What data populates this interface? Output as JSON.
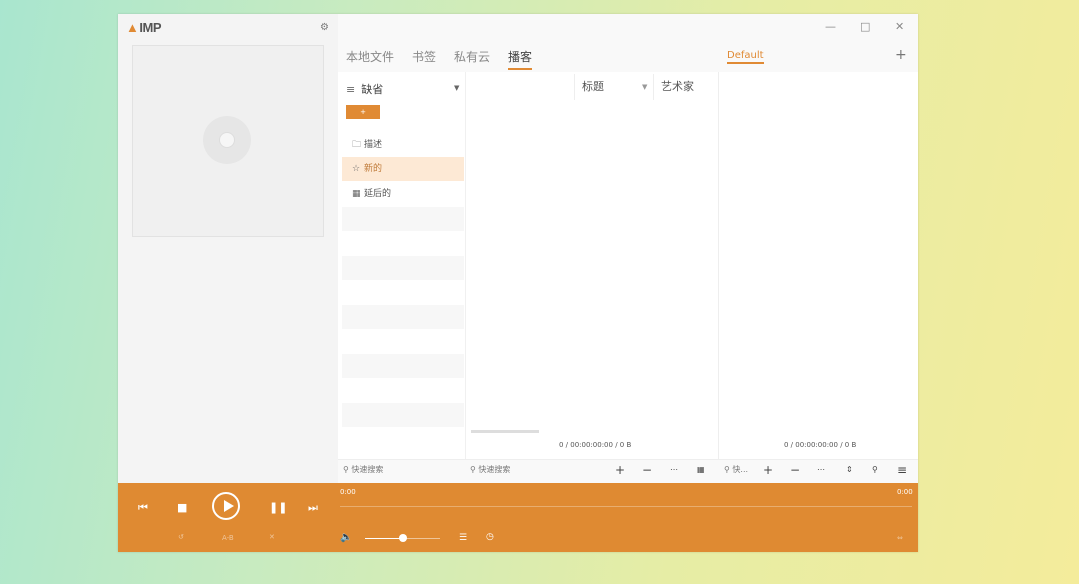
{
  "app": {
    "logo_text": "IMP",
    "logo_mark": "▲"
  },
  "window_controls": {
    "minimize": "—",
    "maximize": "□",
    "close": "✕"
  },
  "tabs": [
    {
      "label": "本地文件"
    },
    {
      "label": "书签"
    },
    {
      "label": "私有云"
    },
    {
      "label": "播客",
      "active": true
    }
  ],
  "playlist_tab": {
    "label": "Default"
  },
  "podcast_panel": {
    "header_label": "缺省",
    "action_button": "+",
    "nav": [
      {
        "label": "描述",
        "icon": "folder-icon"
      },
      {
        "label": "新的",
        "icon": "star-icon",
        "selected": true
      },
      {
        "label": "延后的",
        "icon": "calendar-icon"
      }
    ]
  },
  "columns": {
    "title": "标题",
    "artist": "艺术家"
  },
  "counters": {
    "middle": "0 / 00:00:00:00 / 0 B",
    "right": "0 / 00:00:00:00 / 0 B"
  },
  "search": {
    "left": "快速搜索",
    "middle": "快速搜索",
    "right": "快..."
  },
  "player": {
    "time_left": "0:00",
    "time_right": "0:00",
    "ab_label": "A-B"
  },
  "colors": {
    "accent": "#df8a32",
    "selected_bg": "#fde9d5"
  }
}
